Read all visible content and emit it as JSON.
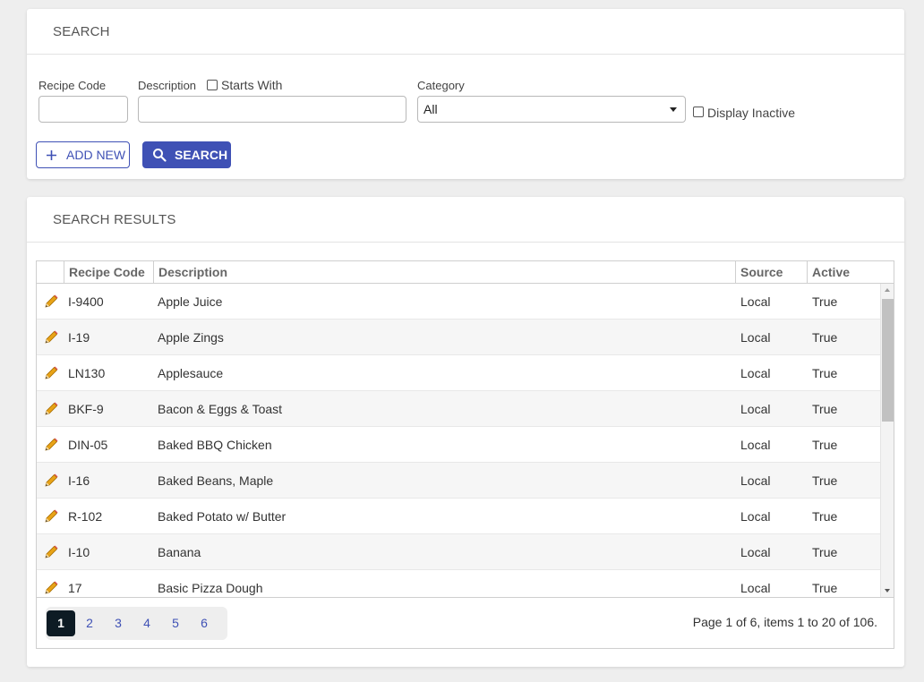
{
  "search_card": {
    "title": "SEARCH",
    "recipe_code_label": "Recipe Code",
    "recipe_code_value": "",
    "description_label": "Description",
    "starts_with_label": "Starts With",
    "starts_with_checked": false,
    "description_value": "",
    "category_label": "Category",
    "category_value": "All",
    "display_inactive_label": "Display Inactive",
    "display_inactive_checked": false,
    "add_new_label": "ADD NEW",
    "search_label": "SEARCH"
  },
  "results_card": {
    "title": "SEARCH RESULTS",
    "columns": [
      "Recipe Code",
      "Description",
      "Source",
      "Active"
    ],
    "rows": [
      {
        "code": "I-9400",
        "description": "Apple Juice",
        "source": "Local",
        "active": "True"
      },
      {
        "code": "I-19",
        "description": "Apple Zings",
        "source": "Local",
        "active": "True"
      },
      {
        "code": "LN130",
        "description": "Applesauce",
        "source": "Local",
        "active": "True"
      },
      {
        "code": "BKF-9",
        "description": "Bacon & Eggs & Toast",
        "source": "Local",
        "active": "True"
      },
      {
        "code": "DIN-05",
        "description": "Baked BBQ Chicken",
        "source": "Local",
        "active": "True"
      },
      {
        "code": "I-16",
        "description": "Baked Beans, Maple",
        "source": "Local",
        "active": "True"
      },
      {
        "code": "R-102",
        "description": "Baked Potato w/ Butter",
        "source": "Local",
        "active": "True"
      },
      {
        "code": "I-10",
        "description": "Banana",
        "source": "Local",
        "active": "True"
      },
      {
        "code": "17",
        "description": "Basic Pizza Dough",
        "source": "Local",
        "active": "True"
      }
    ],
    "pages": [
      "1",
      "2",
      "3",
      "4",
      "5",
      "6"
    ],
    "current_page": "1",
    "pager_info": "Page 1 of 6, items 1 to 20 of 106."
  },
  "icons": {
    "add": "plus-icon",
    "search": "magnifier-icon",
    "edit": "pencil-icon",
    "dropdown": "caret-down-icon"
  },
  "colors": {
    "primary": "#3f51b5",
    "active_page": "#0d1b24",
    "pencil": "#e8a317"
  }
}
